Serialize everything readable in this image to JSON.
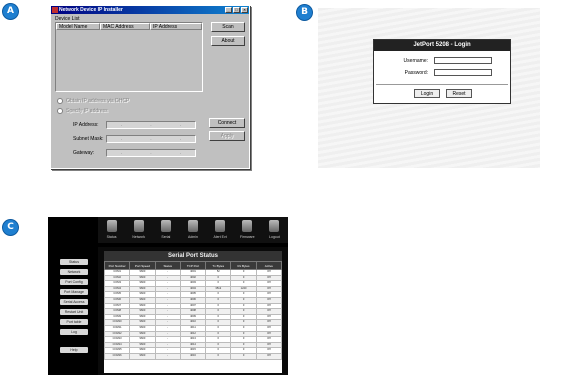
{
  "markers": {
    "a": "A",
    "b": "B",
    "c": "C"
  },
  "dialog": {
    "title": "Network Device IP Installer",
    "title_buttons": [
      "_",
      "□",
      "×"
    ],
    "group_label": "Device List",
    "columns": [
      "Model Name",
      "MAC Address",
      "IP Address"
    ],
    "scan_button": "Scan",
    "about_button": "About",
    "radio_dhcp": "Obtain IP address via DHCP",
    "radio_static": "Specify IP address",
    "ip_label": "IP Address:",
    "mask_label": "Subnet Mask:",
    "gateway_label": "Gateway:",
    "octet_sep": ".",
    "connect_button": "Connect",
    "apply_button": "Apply"
  },
  "login": {
    "title": "JetPort 5208 - Login",
    "username_label": "Username:",
    "password_label": "Password:",
    "username_value": "",
    "password_value": "",
    "login_button": "Login",
    "reset_button": "Reset"
  },
  "jetport": {
    "nav": [
      "Status",
      "Network",
      "Serial",
      "Admin",
      "Alert Evt",
      "Firmware",
      "Logout"
    ],
    "sidebar": [
      "Status",
      "Network",
      "Port Config",
      "Port Manage",
      "Serial Access",
      "Restart Unit",
      "Port table",
      "Log",
      "Help"
    ],
    "table_title": "Serial Port Status",
    "columns": [
      "Port Number",
      "Port Speed",
      "Status",
      "TCP Port",
      "Tx Bytes",
      "Rx Bytes",
      "Active"
    ],
    "rows": [
      [
        "COM1",
        "9600",
        "-",
        "4001",
        "52",
        "0",
        "Off"
      ],
      [
        "COM2",
        "9600",
        "-",
        "4002",
        "0",
        "0",
        "Off"
      ],
      [
        "COM3",
        "9600",
        "-",
        "4003",
        "0",
        "0",
        "Off"
      ],
      [
        "COM4",
        "9600",
        "-",
        "4004",
        "3512",
        "1240",
        "Off"
      ],
      [
        "COM5",
        "9600",
        "-",
        "4005",
        "0",
        "0",
        "Off"
      ],
      [
        "COM6",
        "9600",
        "-",
        "4006",
        "0",
        "0",
        "Off"
      ],
      [
        "COM7",
        "9600",
        "-",
        "4007",
        "0",
        "0",
        "Off"
      ],
      [
        "COM8",
        "9600",
        "-",
        "4008",
        "0",
        "0",
        "Off"
      ],
      [
        "COM9",
        "9600",
        "-",
        "4009",
        "0",
        "0",
        "Off"
      ],
      [
        "COM10",
        "9600",
        "-",
        "4010",
        "0",
        "0",
        "Off"
      ],
      [
        "COM11",
        "9600",
        "-",
        "4011",
        "0",
        "0",
        "Off"
      ],
      [
        "COM12",
        "9600",
        "-",
        "4012",
        "0",
        "0",
        "Off"
      ],
      [
        "COM13",
        "9600",
        "-",
        "4013",
        "0",
        "0",
        "Off"
      ],
      [
        "COM14",
        "9600",
        "-",
        "4014",
        "0",
        "0",
        "Off"
      ],
      [
        "COM15",
        "9600",
        "-",
        "4015",
        "0",
        "0",
        "Off"
      ],
      [
        "COM16",
        "9600",
        "-",
        "4016",
        "0",
        "0",
        "Off"
      ]
    ]
  }
}
